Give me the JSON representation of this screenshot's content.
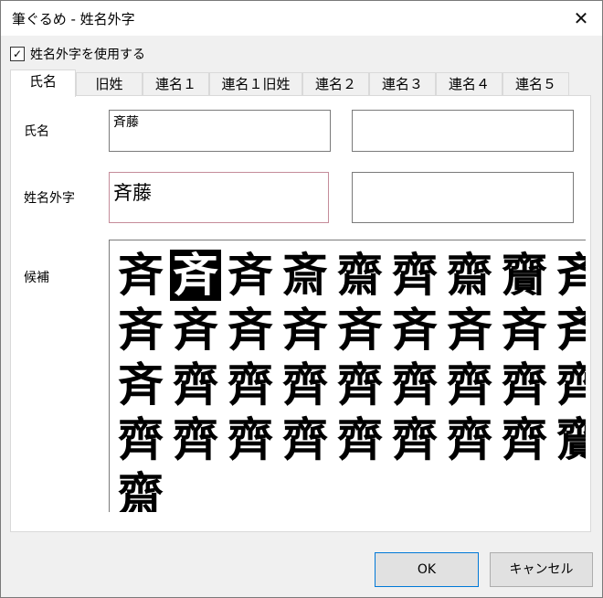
{
  "window": {
    "title": "筆ぐるめ - 姓名外字",
    "close_glyph": "✕"
  },
  "use_gaiji": {
    "label": "姓名外字を使用する",
    "checked": true,
    "check_glyph": "✓"
  },
  "tabs": [
    {
      "label": "氏名",
      "active": true
    },
    {
      "label": "旧姓",
      "active": false
    },
    {
      "label": "連名１",
      "active": false
    },
    {
      "label": "連名１旧姓",
      "active": false
    },
    {
      "label": "連名２",
      "active": false
    },
    {
      "label": "連名３",
      "active": false
    },
    {
      "label": "連名４",
      "active": false
    },
    {
      "label": "連名５",
      "active": false
    }
  ],
  "form": {
    "name_label": "氏名",
    "name_value": "斉藤",
    "name_value_2": "",
    "gaiji_label": "姓名外字",
    "gaiji_value": "斉藤",
    "gaiji_value_2": "",
    "candidates_label": "候補"
  },
  "candidates": {
    "selected_index": 1,
    "rows": [
      [
        "斉",
        "斉",
        "斉",
        "斎",
        "齋",
        "齊",
        "齋",
        "齎",
        "斉"
      ],
      [
        "斉",
        "斉",
        "斉",
        "斉",
        "斉",
        "斉",
        "斉",
        "斉",
        "斉"
      ],
      [
        "斉",
        "齊",
        "齊",
        "齊",
        "齊",
        "齊",
        "齊",
        "齊",
        "齊"
      ],
      [
        "齊",
        "齊",
        "齊",
        "齊",
        "齊",
        "齊",
        "齊",
        "齊",
        "齎"
      ],
      [
        "齋"
      ]
    ]
  },
  "buttons": {
    "ok": "OK",
    "cancel": "キャンセル"
  },
  "colors": {
    "accent": "#0078d7",
    "focus_border": "#c58c9a"
  }
}
